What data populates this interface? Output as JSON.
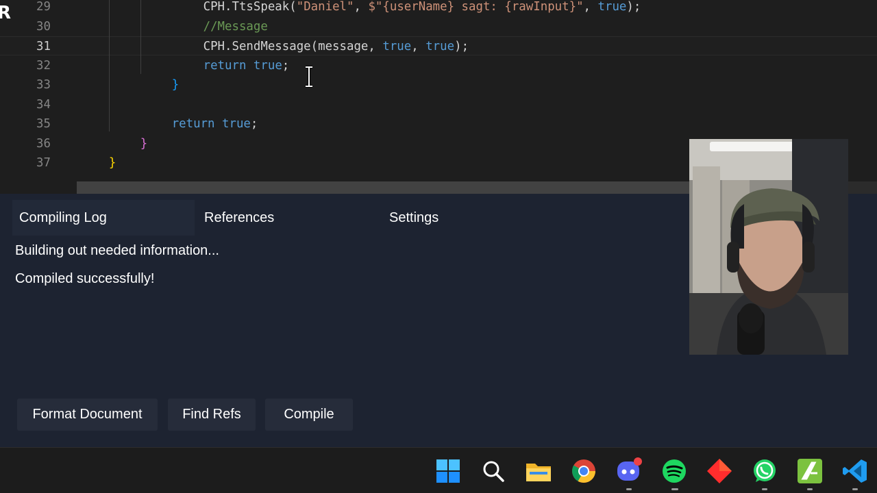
{
  "editor": {
    "lines": [
      {
        "num": "29",
        "indent": 12,
        "tokens": [
          {
            "t": "CPH.TtsSpeak(",
            "c": "plain"
          },
          {
            "t": "\"Daniel\"",
            "c": "string"
          },
          {
            "t": ", ",
            "c": "plain"
          },
          {
            "t": "$\"{userName} sagt: {rawInput}\"",
            "c": "string"
          },
          {
            "t": ", ",
            "c": "plain"
          },
          {
            "t": "true",
            "c": "keyword"
          },
          {
            "t": ");",
            "c": "plain"
          }
        ]
      },
      {
        "num": "30",
        "indent": 12,
        "tokens": [
          {
            "t": "//Message",
            "c": "comment"
          }
        ]
      },
      {
        "num": "31",
        "indent": 12,
        "active": true,
        "tokens": [
          {
            "t": "CPH.SendMessage(message, ",
            "c": "plain"
          },
          {
            "t": "true",
            "c": "keyword"
          },
          {
            "t": ", ",
            "c": "plain"
          },
          {
            "t": "true",
            "c": "keyword"
          },
          {
            "t": ");",
            "c": "plain"
          }
        ]
      },
      {
        "num": "32",
        "indent": 12,
        "tokens": [
          {
            "t": "return",
            "c": "keyword"
          },
          {
            "t": " ",
            "c": "plain"
          },
          {
            "t": "true",
            "c": "keyword"
          },
          {
            "t": ";",
            "c": "plain"
          }
        ]
      },
      {
        "num": "33",
        "indent": 9,
        "tokens": [
          {
            "t": "}",
            "c": "brace-blue"
          }
        ]
      },
      {
        "num": "34",
        "indent": 0,
        "tokens": []
      },
      {
        "num": "35",
        "indent": 9,
        "tokens": [
          {
            "t": "return",
            "c": "keyword"
          },
          {
            "t": " ",
            "c": "plain"
          },
          {
            "t": "true",
            "c": "keyword"
          },
          {
            "t": ";",
            "c": "plain"
          }
        ]
      },
      {
        "num": "36",
        "indent": 6,
        "tokens": [
          {
            "t": "}",
            "c": "brace-pink"
          }
        ]
      },
      {
        "num": "37",
        "indent": 3,
        "tokens": [
          {
            "t": "}",
            "c": "brace-yellow"
          }
        ]
      }
    ]
  },
  "panel": {
    "tabs": [
      {
        "label": "Compiling Log",
        "active": true
      },
      {
        "label": "References",
        "active": false
      },
      {
        "label": "Settings",
        "active": false
      }
    ],
    "log_lines": [
      "Building out needed information...",
      "Compiled successfully!"
    ],
    "buttons": {
      "format": "Format Document",
      "find_refs": "Find Refs",
      "compile": "Compile"
    }
  },
  "taskbar": {
    "icons": [
      {
        "name": "windows-start-icon"
      },
      {
        "name": "search-icon"
      },
      {
        "name": "file-explorer-icon"
      },
      {
        "name": "chrome-icon"
      },
      {
        "name": "discord-icon"
      },
      {
        "name": "spotify-icon"
      },
      {
        "name": "red-diamond-app-icon"
      },
      {
        "name": "whatsapp-icon"
      },
      {
        "name": "green-app-icon"
      },
      {
        "name": "vscode-icon"
      }
    ]
  },
  "colors": {
    "editor_bg": "#1e1e1e",
    "panel_bg": "#1d2331",
    "keyword": "#569cd6",
    "string": "#ce9178",
    "comment": "#6a9955"
  }
}
